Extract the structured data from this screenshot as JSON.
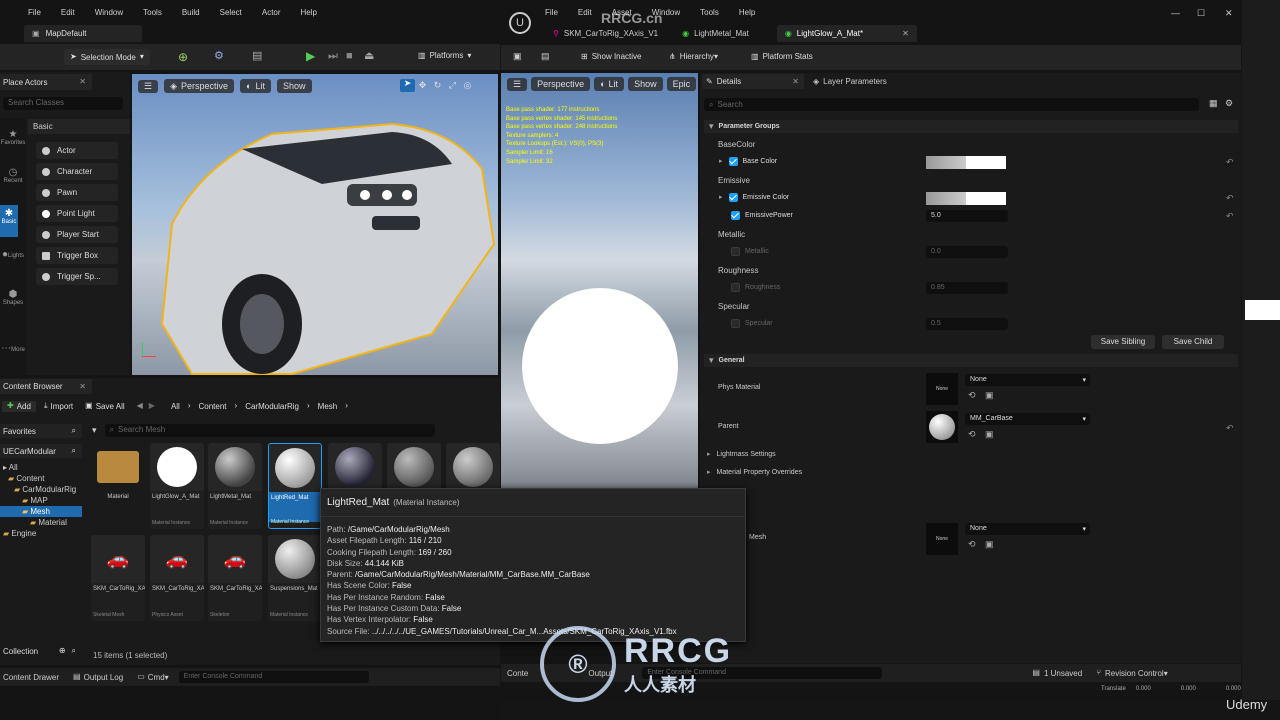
{
  "left_window": {
    "menu": [
      "File",
      "Edit",
      "Window",
      "Tools",
      "Build",
      "Select",
      "Actor",
      "Help"
    ],
    "tab": "MapDefault",
    "toolbar": {
      "selection_mode": "Selection Mode",
      "platforms": "Platforms"
    },
    "place_actors": {
      "tab": "Place Actors",
      "search_placeholder": "Search Classes",
      "category_header": "Basic",
      "categories": [
        "Favorites",
        "Recent",
        "Basic",
        "Lights",
        "Shapes",
        "More"
      ],
      "actors": [
        "Actor",
        "Character",
        "Pawn",
        "Point Light",
        "Player Start",
        "Trigger Box",
        "Trigger Sp..."
      ]
    },
    "viewport": {
      "perspective": "Perspective",
      "lit": "Lit",
      "show": "Show"
    },
    "content_browser": {
      "tab": "Content Browser",
      "add": "Add",
      "import": "Import",
      "save_all": "Save All",
      "breadcrumb": [
        "All",
        "Content",
        "CarModularRig",
        "Mesh"
      ],
      "favorites": "Favorites",
      "folder_root": "UECarModular",
      "tree": [
        "All",
        "Content",
        "CarModularRig",
        "MAP",
        "Mesh",
        "Material",
        "Engine"
      ],
      "search_placeholder": "Search Mesh",
      "assets": [
        {
          "name": "Material",
          "type": ""
        },
        {
          "name": "LightGlow_A_Mat",
          "type": "Material Instance"
        },
        {
          "name": "LightMetal_Mat",
          "type": "Material Instance"
        },
        {
          "name": "LightRed_Mat",
          "type": "Material Instance"
        },
        {
          "name": "",
          "type": ""
        },
        {
          "name": "",
          "type": ""
        },
        {
          "name": "",
          "type": ""
        },
        {
          "name": "SKM_CarToRig_XAxis_V1",
          "type": "Skeletal Mesh"
        },
        {
          "name": "SKM_CarToRig_XAxis_V...",
          "type": "Physics Asset"
        },
        {
          "name": "SKM_CarToRig_XAxis_V...",
          "type": "Skeleton"
        },
        {
          "name": "Suspensions_Mat",
          "type": "Material Instance"
        }
      ],
      "collection": "Collection",
      "items_status": "15 items (1 selected)"
    },
    "bottom": {
      "content_drawer": "Content Drawer",
      "output_log": "Output Log",
      "cmd": "Cmd",
      "console_placeholder": "Enter Console Command"
    }
  },
  "right_window": {
    "menu": [
      "File",
      "Edit",
      "Asset",
      "Window",
      "Tools",
      "Help"
    ],
    "tabs": [
      "SKM_CarToRig_XAxis_V1",
      "LightMetal_Mat",
      "LightGlow_A_Mat*"
    ],
    "toolbar": {
      "show_inactive": "Show Inactive",
      "hierarchy": "Hierarchy",
      "platform_stats": "Platform Stats"
    },
    "viewport": {
      "perspective": "Perspective",
      "lit": "Lit",
      "show": "Show",
      "epic": "Epic"
    },
    "stats": [
      "Base pass shader: 177 instructions",
      "Base pass vertex shader: 145 instructions",
      "Base pass vertex shader: 248 instructions",
      "Texture samplers: 4",
      "Texture Lookups (Est.): VS(0), PS(3)",
      "Sampler Limit: 16",
      "Sampler Limit: 32"
    ],
    "details": {
      "tab": "Details",
      "layer_tab": "Layer Parameters",
      "search_placeholder": "Search",
      "parameter_groups": "Parameter Groups",
      "base_color_group": "BaseColor",
      "base_color": "Base Color",
      "emissive_group": "Emissive",
      "emissive_color": "Emissive Color",
      "emissive_power": "EmissivePower",
      "emissive_power_value": "5.0",
      "metallic_group": "Metallic",
      "metallic": "Metallic",
      "metallic_value": "0.0",
      "roughness_group": "Roughness",
      "roughness": "Roughness",
      "roughness_value": "0.85",
      "specular_group": "Specular",
      "specular": "Specular",
      "specular_value": "0.5",
      "save_sibling": "Save Sibling",
      "save_child": "Save Child",
      "general": "General",
      "phys_material": "Phys Material",
      "phys_value": "None",
      "none_thumb": "None",
      "parent": "Parent",
      "parent_value": "MM_CarBase",
      "lightmass": "Lightmass Settings",
      "overrides": "Material Property Overrides",
      "mesh_label": "Mesh",
      "mesh_value": "None"
    },
    "bottom": {
      "content": "Conte",
      "output": "Output",
      "console_placeholder": "Enter Console Command",
      "unsaved": "1 Unsaved",
      "revision": "Revision Control",
      "translate": "Translate",
      "t1": "0.000",
      "t2": "0.000",
      "t3": "0.000"
    }
  },
  "tooltip": {
    "title": "LightRed_Mat",
    "subtitle": "(Material Instance)",
    "lines": [
      [
        "Path:",
        "/Game/CarModularRig/Mesh"
      ],
      [
        "Asset Filepath Length:",
        "116 / 210"
      ],
      [
        "Cooking Filepath Length:",
        "169 / 260"
      ],
      [
        "Disk Size:",
        "44.144 KiB"
      ],
      [
        "Parent:",
        "/Game/CarModularRig/Mesh/Material/MM_CarBase.MM_CarBase"
      ],
      [
        "Has Scene Color:",
        "False"
      ],
      [
        "Has Per Instance Random:",
        "False"
      ],
      [
        "Has Per Instance Custom Data:",
        "False"
      ],
      [
        "Has Vertex Interpolator:",
        "False"
      ],
      [
        "Source File:",
        "../../../../../UE_GAMES/Tutorials/Unreal_Car_M...Assets/SKM_CarToRig_XAxis_V1.fbx"
      ]
    ]
  },
  "watermarks": {
    "top": "RRCG.cn",
    "logo": "RRCG",
    "logo_sub": "人人素材",
    "udemy": "Udemy"
  },
  "colors": {
    "accent": "#1ea0ff",
    "panel": "#1a1a1a",
    "viewport_outline": "#f2b418"
  }
}
